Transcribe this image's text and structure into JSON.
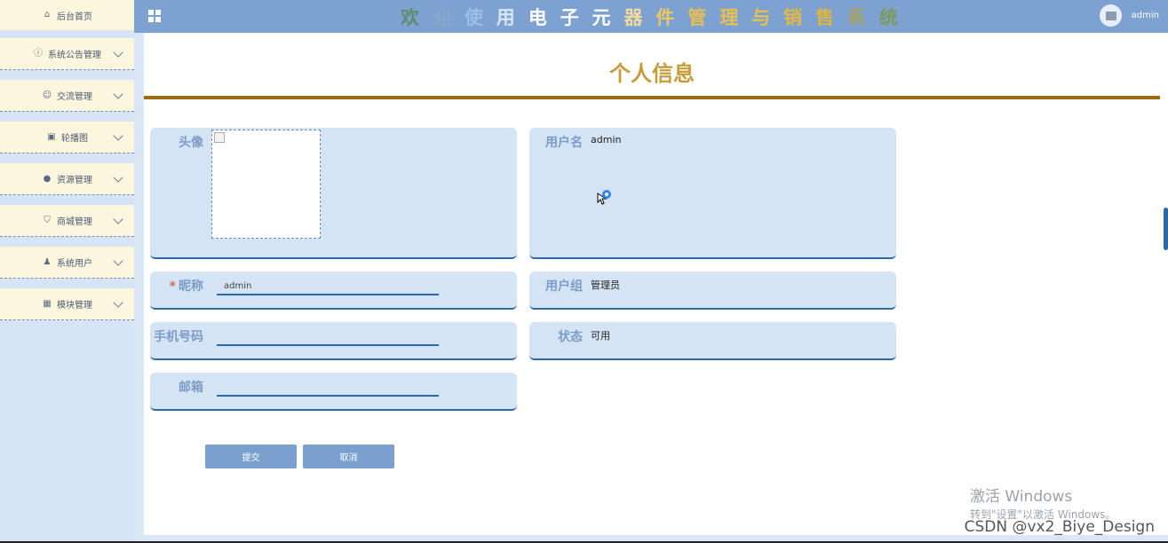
{
  "topbar": {
    "banner_chars": [
      {
        "ch": "欢",
        "color": "#5e8a6e"
      },
      {
        "ch": "迎",
        "color": "#8aa6c8"
      },
      {
        "ch": "使",
        "color": "#9cc0e6"
      },
      {
        "ch": "用",
        "color": "#d9e6f5"
      },
      {
        "ch": "电",
        "color": "#ffffff"
      },
      {
        "ch": "子",
        "color": "#ffffff"
      },
      {
        "ch": "元",
        "color": "#ffffff"
      },
      {
        "ch": "器",
        "color": "#f3d99a"
      },
      {
        "ch": "件",
        "color": "#f0c85a"
      },
      {
        "ch": "管",
        "color": "#e9c050"
      },
      {
        "ch": "理",
        "color": "#e9c050"
      },
      {
        "ch": "与",
        "color": "#e9c050"
      },
      {
        "ch": "销",
        "color": "#e2b845"
      },
      {
        "ch": "售",
        "color": "#d9b447"
      },
      {
        "ch": "系",
        "color": "#a9a060"
      },
      {
        "ch": "统",
        "color": "#7c9a5a"
      }
    ],
    "username": "admin"
  },
  "sidebar": {
    "home": "后台首页",
    "items": [
      {
        "label": "系统公告管理",
        "icon": "info-circle-icon",
        "glyph": "ⓘ"
      },
      {
        "label": "交流管理",
        "icon": "chat-bubble-icon",
        "glyph": "☺"
      },
      {
        "label": "轮播图",
        "icon": "picture-icon",
        "glyph": "▣"
      },
      {
        "label": "资源管理",
        "icon": "lightbulb-icon",
        "glyph": "●"
      },
      {
        "label": "商城管理",
        "icon": "shopping-cart-icon",
        "glyph": "⛉"
      },
      {
        "label": "系统用户",
        "icon": "user-icon",
        "glyph": "♟"
      },
      {
        "label": "模块管理",
        "icon": "grid-icon",
        "glyph": "▦"
      }
    ]
  },
  "main": {
    "title": "个人信息",
    "fields": {
      "avatar_label": "头像",
      "username_label": "用户名",
      "username_value": "admin",
      "nickname_label": "昵称",
      "nickname_value": "admin",
      "required_mark": "*",
      "group_label": "用户组",
      "group_value": "管理员",
      "phone_label": "手机号码",
      "phone_value": "",
      "status_label": "状态",
      "status_value": "可用",
      "email_label": "邮箱",
      "email_value": ""
    },
    "buttons": {
      "submit": "提交",
      "cancel": "取消"
    }
  },
  "watermark": {
    "line1": "激活 Windows",
    "line2": "转到\"设置\"以激活 Windows。",
    "csdn": "CSDN @vx2_Biye_Design"
  }
}
